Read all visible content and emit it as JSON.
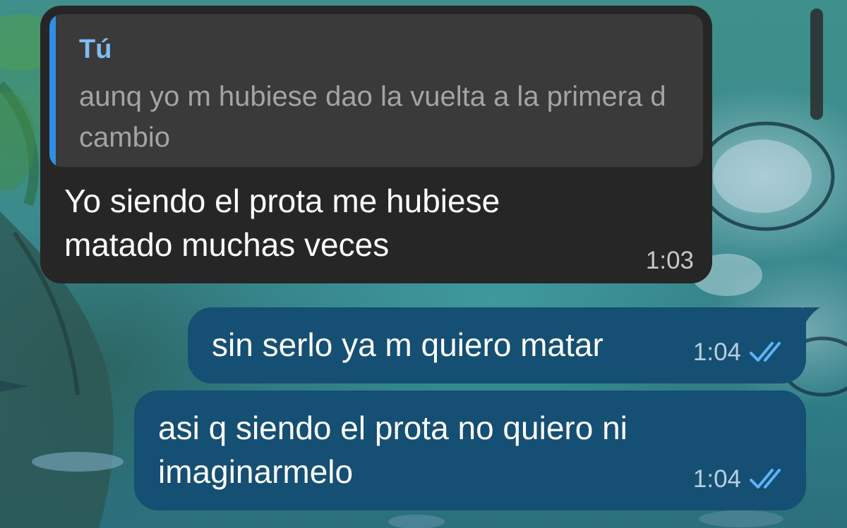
{
  "chat": {
    "incoming": {
      "reply": {
        "author": "Tú",
        "text": "aunq yo m hubiese dao la vuelta a la primera d cambio"
      },
      "text": "Yo siendo el prota me hubiese\nmatado muchas veces",
      "time": "1:03"
    },
    "outgoing": [
      {
        "text": "sin serlo ya m quiero matar",
        "time": "1:04",
        "status_icon": "double-check-icon"
      },
      {
        "text": "asi q siendo el prota no quiero ni\nimaginarmelo",
        "time": "1:04",
        "status_icon": "double-check-icon"
      }
    ]
  },
  "colors": {
    "incoming_bubble": "#262626",
    "reply_box": "#3a3a3a",
    "reply_accent": "#2f8fe4",
    "reply_author": "#7fbdf2",
    "outgoing_bubble": "#154f73",
    "read_check": "#5eb3f5"
  }
}
